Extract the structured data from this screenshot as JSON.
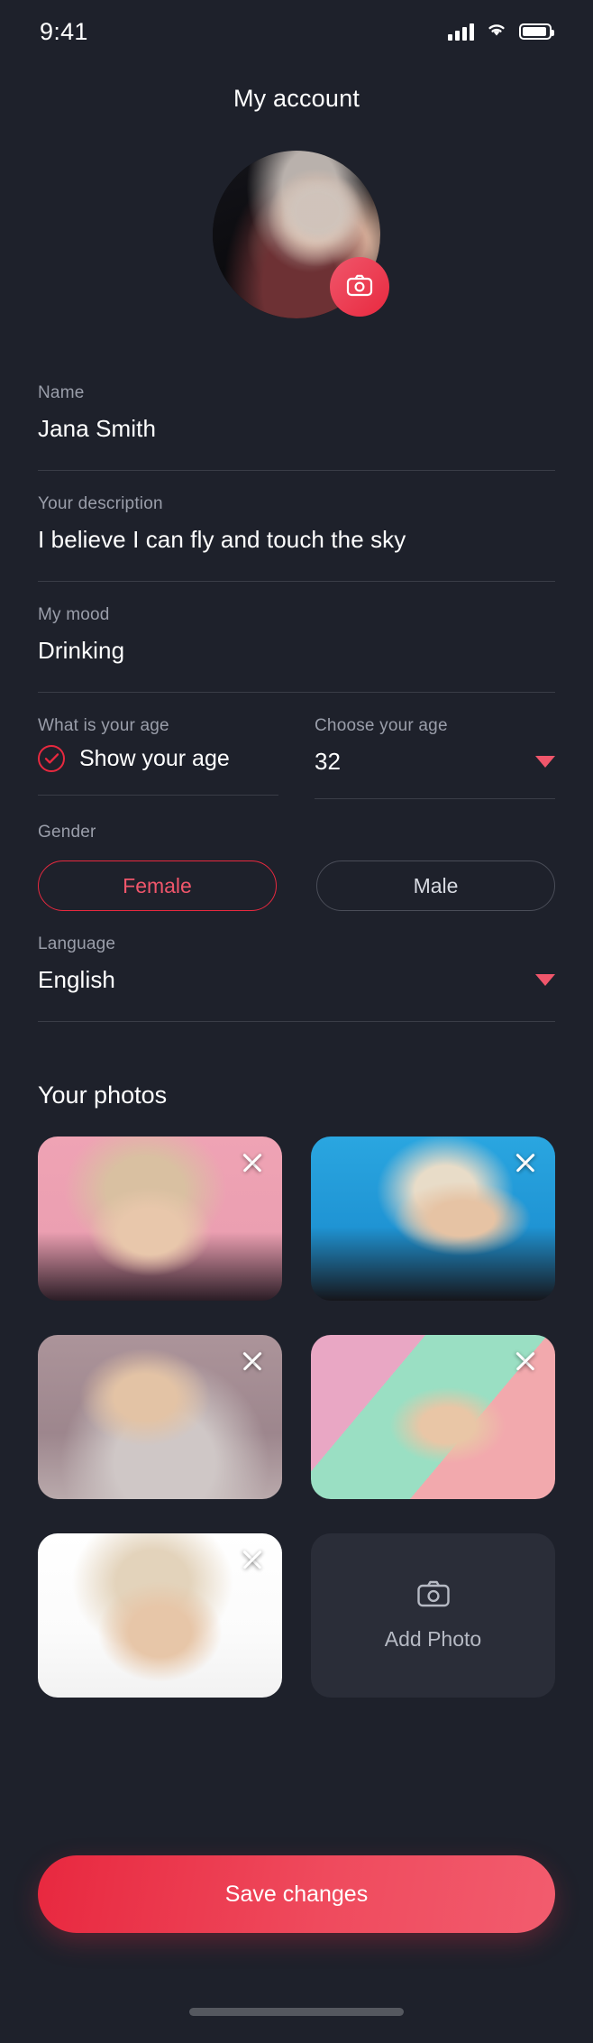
{
  "status_bar": {
    "time": "9:41",
    "signal_icon": "cellular-signal-icon",
    "wifi_icon": "wifi-icon",
    "battery_icon": "battery-icon"
  },
  "header": {
    "title": "My account"
  },
  "avatar": {
    "name": "profile-avatar",
    "camera_icon": "camera-icon"
  },
  "theme": {
    "background": "#1e212b",
    "accent": "#e8293f",
    "accent_light": "#f0566b",
    "label_gray": "#9a9eaa",
    "value_white": "#ffffff",
    "divider": "#3a3d47",
    "card": "#2a2d38"
  },
  "fields": {
    "name": {
      "label": "Name",
      "value": "Jana Smith"
    },
    "description": {
      "label": "Your description",
      "value": "I believe I can fly and touch the sky"
    },
    "mood": {
      "label": "My mood",
      "value": "Drinking"
    },
    "age_toggle": {
      "label": "What is your age",
      "value": "Show your age",
      "checked": true,
      "check_icon": "check-circle-icon"
    },
    "age_select": {
      "label": "Choose your age",
      "value": "32",
      "caret_icon": "caret-down-icon"
    },
    "gender": {
      "label": "Gender",
      "options": [
        {
          "label": "Female",
          "selected": true
        },
        {
          "label": "Male",
          "selected": false
        }
      ]
    },
    "language": {
      "label": "Language",
      "value": "English",
      "caret_icon": "caret-down-icon"
    }
  },
  "photos": {
    "title": "Your photos",
    "remove_icon": "close-x-icon",
    "items": [
      {
        "id": "photo-1",
        "alt": "Portrait on pink background"
      },
      {
        "id": "photo-2",
        "alt": "Portrait on blue background"
      },
      {
        "id": "photo-3",
        "alt": "Portrait in silver jacket"
      },
      {
        "id": "photo-4",
        "alt": "Portrait on pastel background"
      },
      {
        "id": "photo-5",
        "alt": "Portrait on white background"
      }
    ],
    "add_tile": {
      "label": "Add Photo",
      "icon": "camera-icon"
    }
  },
  "actions": {
    "save_label": "Save changes"
  }
}
